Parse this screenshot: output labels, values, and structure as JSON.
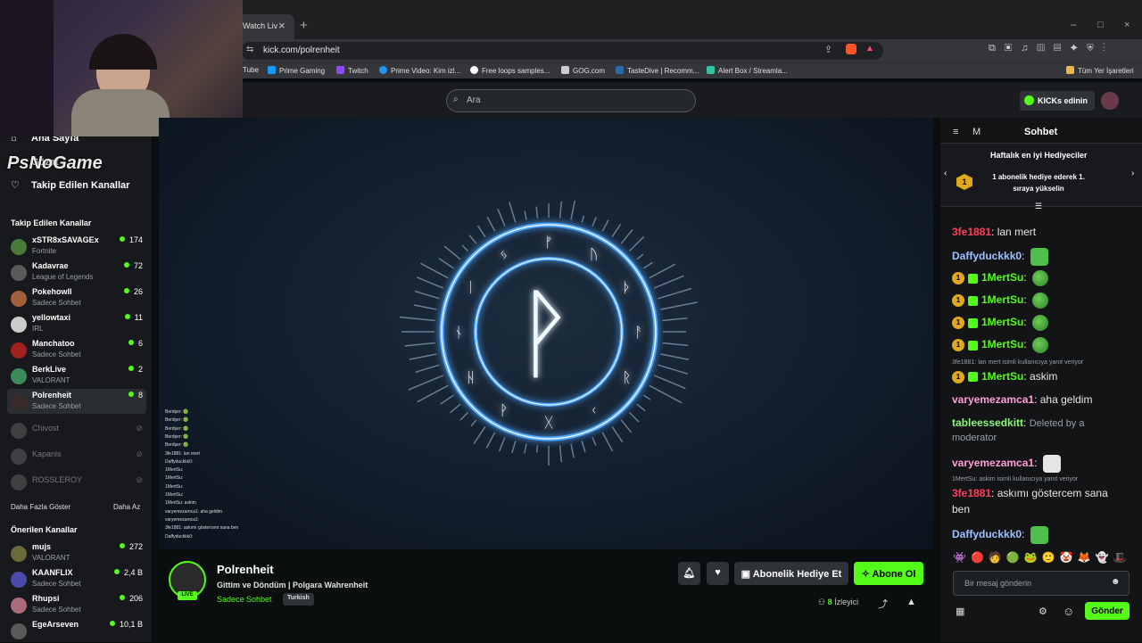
{
  "browser": {
    "tab_title": "Watch Liv",
    "tab_close": "×",
    "new_tab": "+",
    "url": "kick.com/polrenheit",
    "window_controls": [
      "–",
      "□",
      "×"
    ],
    "bookmarks": [
      "Tube",
      "Prime Gaming",
      "Twitch",
      "Prime Video: Kim izl...",
      "Free loops samples...",
      "GOG.com",
      "TasteDive | Recomm...",
      "Alert Box / Streamla..."
    ],
    "all_bookmarks": "Tüm Yer İşaretleri"
  },
  "header": {
    "search_placeholder": "Ara",
    "kicks_button": "KICKs edinin"
  },
  "sidebar": {
    "nav_home": "Ana Sayfa",
    "nav_browse": "Gözat",
    "nav_following": "Takip Edilen Kanallar",
    "logo_overlay": "PsNoGame",
    "following_title": "Takip Edilen Kanallar",
    "following": [
      {
        "name": "xSTR8xSAVAGEx",
        "game": "Fortnite",
        "viewers": "174",
        "color": "#4a7a3a"
      },
      {
        "name": "Kadavrae",
        "game": "League of Legends",
        "viewers": "72",
        "color": "#5a5a5a"
      },
      {
        "name": "Pokehowll",
        "game": "Sadece Sohbet",
        "viewers": "26",
        "color": "#a0603a"
      },
      {
        "name": "yellowtaxi",
        "game": "IRL",
        "viewers": "11",
        "color": "#ccc"
      },
      {
        "name": "Manchatoo",
        "game": "Sadece Sohbet",
        "viewers": "6",
        "color": "#a02020"
      },
      {
        "name": "BerkLive",
        "game": "VALORANT",
        "viewers": "2",
        "color": "#3a8a5a"
      },
      {
        "name": "Polrenheit",
        "game": "Sadece Sohbet",
        "viewers": "8",
        "color": "#3a2a2a"
      }
    ],
    "offline": [
      {
        "name": "Chivost",
        "color": "#888"
      },
      {
        "name": "Kapanis",
        "color": "#888"
      },
      {
        "name": "ROSSLEROY",
        "color": "#888"
      }
    ],
    "show_more": "Daha Fazla Göster",
    "show_less": "Daha Az",
    "recommended_title": "Önerilen Kanallar",
    "recommended": [
      {
        "name": "mujs",
        "game": "VALORANT",
        "viewers": "272",
        "color": "#6a6a3a"
      },
      {
        "name": "KAANFLIX",
        "game": "Sadece Sohbet",
        "viewers": "2,4 B",
        "color": "#4a4aaa"
      },
      {
        "name": "Rhupsi",
        "game": "Sadece Sohbet",
        "viewers": "206",
        "color": "#aa6a7a"
      },
      {
        "name": "EgeArseven",
        "game": "",
        "viewers": "10,1 B",
        "color": "#5a5a5a"
      }
    ]
  },
  "video": {
    "runes": [
      "ᚠ",
      "ᚢ",
      "ᚦ",
      "ᚨ",
      "ᚱ",
      "ᚲ",
      "ᚷ",
      "ᚹ",
      "ᚺ",
      "ᚾ",
      "ᛁ",
      "ᛃ"
    ],
    "center_rune": "ᚹ",
    "overlay_chat": [
      "Berdşer: 🟢",
      "Berdşer: 🟢",
      "Berdşer: 🟢",
      "Berdşer: 🟢",
      "Berdşer: 🟢",
      "3fe1881: lan mert",
      "Daffyduckkk0:",
      "1MertSu:",
      "1MertSu:",
      "1MertSu:",
      "1MertSu:",
      "1MertSu: askim",
      "varyemezamca1: aha geldim",
      "varyemezamca1:",
      "3fe1881: askımı göstercem sana ben",
      "Daffyduckkk0:"
    ]
  },
  "stream": {
    "name": "Polrenheit",
    "title": "Gittim ve Döndüm | Polgara Wahrenheit",
    "category": "Sadece Sohbet",
    "tag": "Turkish",
    "live": "LIVE",
    "gift_sub": "Abonelik Hediye Et",
    "subscribe": "Abone Ol",
    "viewers": "8",
    "viewers_label": "İzleyici"
  },
  "chat": {
    "header_title": "Sohbet",
    "header_m": "M",
    "top_gifters_title": "Haftalık en iyi Hediyeciler",
    "top_gifters_rank": "1",
    "top_gifters_msg": "1 abonelik hediye ederek 1. sıraya yükselin",
    "messages": [
      {
        "user": "3fe1881",
        "color": "#ff3f5a",
        "text": "lan mert"
      },
      {
        "user": "Daffyduckkk0",
        "color": "#9ec1ff",
        "text": ""
      },
      {
        "user": "1MertSu",
        "color": "#53fc18",
        "text": ""
      },
      {
        "user": "1MertSu",
        "color": "#53fc18",
        "text": ""
      },
      {
        "user": "1MertSu",
        "color": "#53fc18",
        "text": ""
      },
      {
        "user": "1MertSu",
        "color": "#53fc18",
        "text": ""
      },
      {
        "reply": "3fe1881: lan mert isimli kullanıcıya yanıt veriyor"
      },
      {
        "user": "1MertSu",
        "color": "#53fc18",
        "text": "askim"
      },
      {
        "user": "varyemezamca1",
        "color": "#ff9ed8",
        "text": "aha geldim"
      },
      {
        "user": "tableessedkitt",
        "color": "#8ef47a",
        "text": "Deleted by a",
        "text2": "moderator"
      },
      {
        "user": "varyemezamca1",
        "color": "#ff9ed8",
        "text": ""
      },
      {
        "reply": "1MertSu: askim isimli kullanıcıya yanıt veriyor"
      },
      {
        "user": "3fe1881",
        "color": "#ff3f5a",
        "text": "askımı göstercem sana",
        "text2": "ben"
      },
      {
        "user": "Daffyduckkk0",
        "color": "#9ec1ff",
        "text": ""
      }
    ],
    "input_placeholder": "Bir mesaj gönderin",
    "send": "Gönder"
  }
}
